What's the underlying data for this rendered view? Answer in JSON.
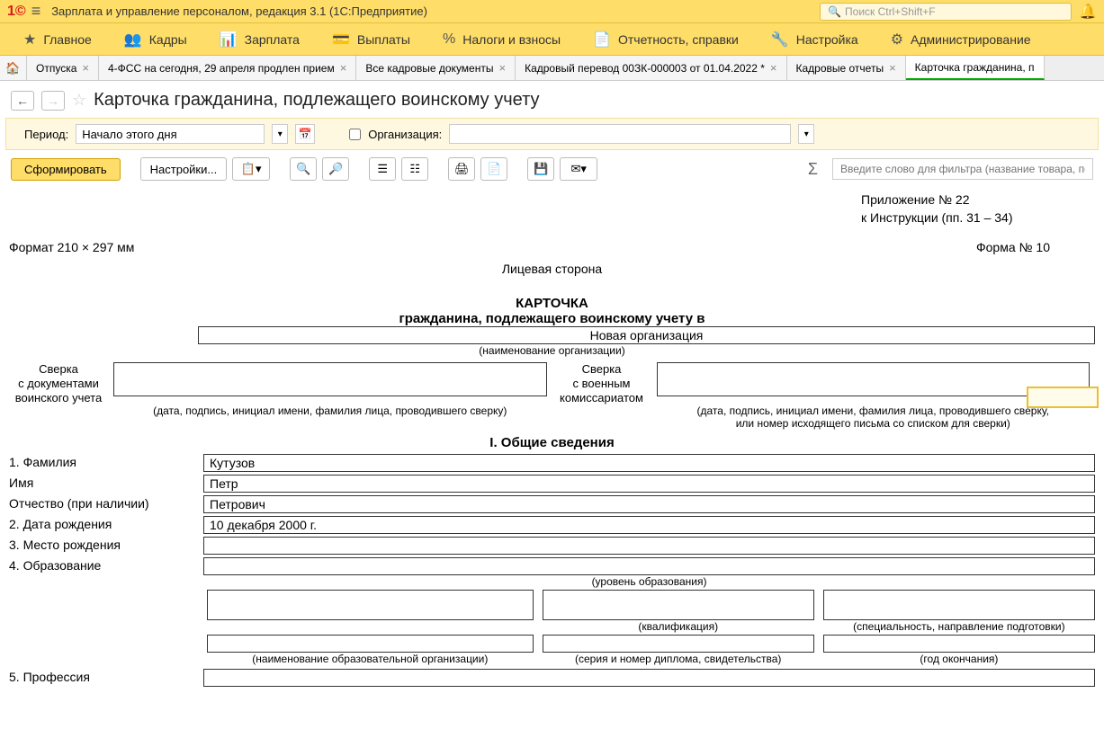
{
  "app": {
    "title": "Зарплата и управление персоналом, редакция 3.1  (1С:Предприятие)",
    "search_placeholder": "Поиск Ctrl+Shift+F"
  },
  "menu": {
    "main": "Главное",
    "hr": "Кадры",
    "salary": "Зарплата",
    "payments": "Выплаты",
    "taxes": "Налоги и взносы",
    "reports": "Отчетность, справки",
    "settings": "Настройка",
    "admin": "Администрирование"
  },
  "tabs": {
    "t1": "Отпуска",
    "t2": "4-ФСС на сегодня, 29 апреля продлен прием",
    "t3": "Все кадровые документы",
    "t4": "Кадровый перевод 00ЗК-000003 от 01.04.2022 *",
    "t5": "Кадровые отчеты",
    "t6": "Карточка гражданина, п"
  },
  "page": {
    "title": "Карточка гражданина, подлежащего воинскому учету"
  },
  "filter": {
    "period_label": "Период:",
    "period_value": "Начало этого дня",
    "org_label": "Организация:"
  },
  "toolbar": {
    "generate": "Сформировать",
    "settings": "Настройки...",
    "filter_placeholder": "Введите слово для фильтра (название товара, по"
  },
  "doc": {
    "app_num": "Приложение № 22",
    "instr": "к Инструкции (пп. 31 – 34)",
    "format": "Формат 210 × 297 мм",
    "form": "Форма № 10",
    "side": "Лицевая сторона",
    "card_title": "КАРТОЧКА",
    "card_sub": "гражданина, подлежащего воинскому учету в",
    "org_name": "Новая организация",
    "org_hint": "(наименование организации)",
    "sverka1_l1": "Сверка",
    "sverka1_l2": "с документами",
    "sverka1_l3": "воинского учета",
    "sverka1_hint": "(дата, подпись, инициал имени, фамилия лица, проводившего сверку)",
    "sverka2_l1": "Сверка",
    "sverka2_l2": "с военным",
    "sverka2_l3": "комиссариатом",
    "sverka2_hint1": "(дата, подпись, инициал имени, фамилия лица, проводившего сверку,",
    "sverka2_hint2": "или номер исходящего письма со списком для сверки)",
    "section1": "I. Общие сведения",
    "lbl_surname": "1. Фамилия",
    "val_surname": "Кутузов",
    "lbl_name": "Имя",
    "val_name": "Петр",
    "lbl_patr": "Отчество (при наличии)",
    "val_patr": "Петрович",
    "lbl_dob": "2. Дата рождения",
    "val_dob": "10 декабря 2000 г.",
    "lbl_pob": "3. Место рождения",
    "lbl_edu": "4. Образование",
    "hint_edu_level": "(уровень образования)",
    "hint_qual": "(квалификация)",
    "hint_spec": "(специальность, направление подготовки)",
    "hint_edu_org": "(наименование образовательной организации)",
    "hint_diploma": "(серия и номер диплома, свидетельства)",
    "hint_year": "(год окончания)",
    "lbl_prof": "5. Профессия"
  }
}
